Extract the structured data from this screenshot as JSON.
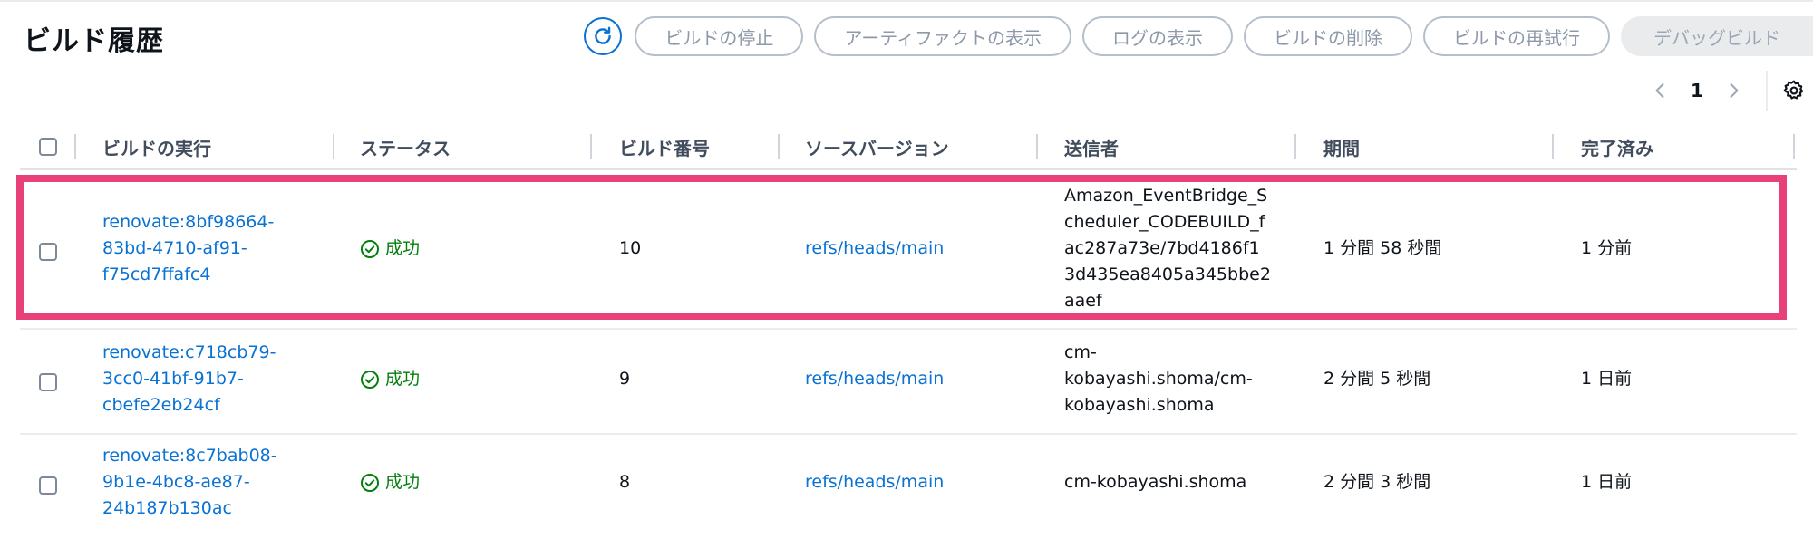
{
  "header": {
    "title": "ビルド履歴"
  },
  "toolbar": {
    "refresh_icon": "refresh-icon",
    "stop_label": "ビルドの停止",
    "artifacts_label": "アーティファクトの表示",
    "logs_label": "ログの表示",
    "delete_label": "ビルドの削除",
    "retry_label": "ビルドの再試行",
    "debug_label": "デバッグビルド"
  },
  "pagination": {
    "current_page": "1"
  },
  "table": {
    "columns": [
      "ビルドの実行",
      "ステータス",
      "ビルド番号",
      "ソースバージョン",
      "送信者",
      "期間",
      "完了済み"
    ],
    "rows": [
      {
        "run_lines": [
          "renovate:8bf98664-",
          "83bd-4710-af91-",
          "f75cd7ffafc4"
        ],
        "status": "成功",
        "build_number": "10",
        "source_version": "refs/heads/main",
        "submitter_lines": [
          "Amazon_EventBridge_S",
          "cheduler_CODEBUILD_f",
          "ac287a73e/7bd4186f1",
          "3d435ea8405a345bbe2",
          "aaef"
        ],
        "duration": "1 分間 58 秒間",
        "completed": "1 分前"
      },
      {
        "run_lines": [
          "renovate:c718cb79-",
          "3cc0-41bf-91b7-",
          "cbefe2eb24cf"
        ],
        "status": "成功",
        "build_number": "9",
        "source_version": "refs/heads/main",
        "submitter_lines": [
          "cm-",
          "kobayashi.shoma/cm-",
          "kobayashi.shoma"
        ],
        "duration": "2 分間 5 秒間",
        "completed": "1 日前"
      },
      {
        "run_lines": [
          "renovate:8c7bab08-",
          "9b1e-4bc8-ae87-",
          "24b187b130ac"
        ],
        "status": "成功",
        "build_number": "8",
        "source_version": "refs/heads/main",
        "submitter_lines": [
          "cm-kobayashi.shoma"
        ],
        "duration": "2 分間 3 秒間",
        "completed": "1 日前"
      }
    ]
  },
  "colors": {
    "accent": "#0972d3",
    "success": "#037f0c",
    "highlight": "#e8417a"
  }
}
